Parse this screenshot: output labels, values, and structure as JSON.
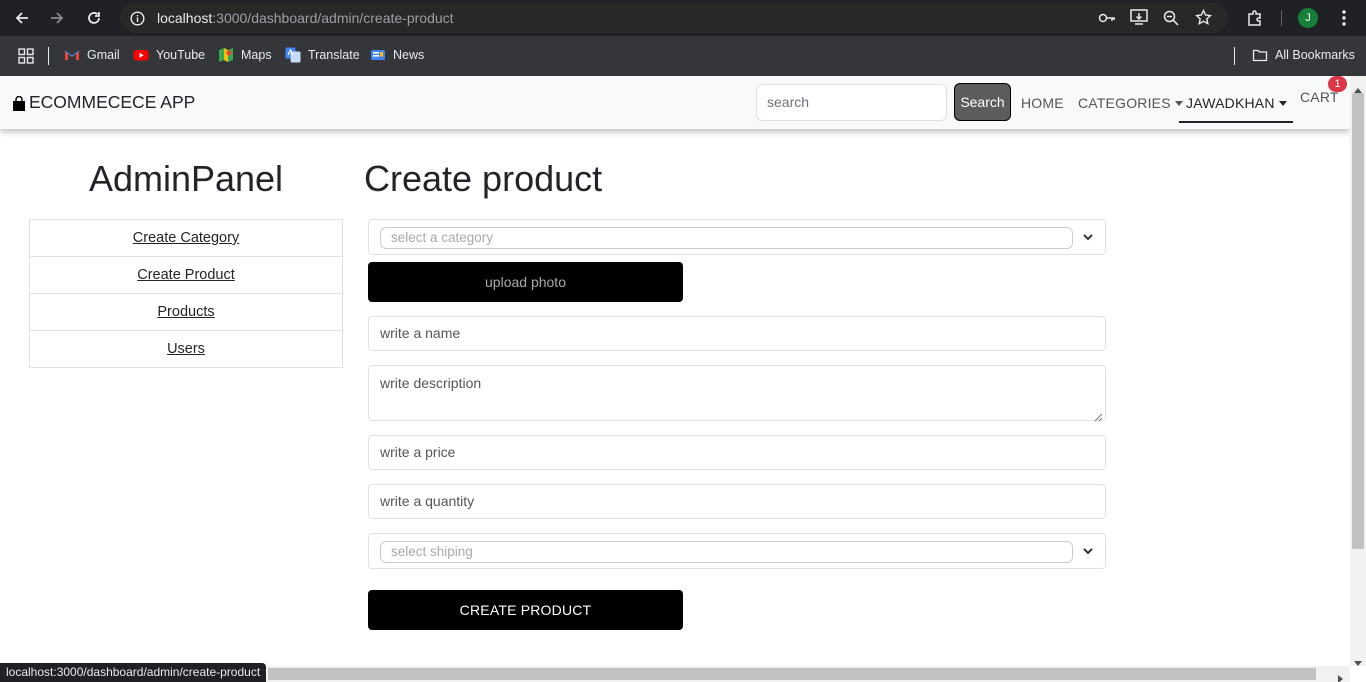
{
  "browser": {
    "url_host": "localhost",
    "url_path": ":3000/dashboard/admin/create-product",
    "status_url": "localhost:3000/dashboard/admin/create-product",
    "profile_initial": "J",
    "bookmarks": [
      {
        "label": "Gmail",
        "icon": "gmail-icon"
      },
      {
        "label": "YouTube",
        "icon": "youtube-icon"
      },
      {
        "label": "Maps",
        "icon": "maps-icon"
      },
      {
        "label": "Translate",
        "icon": "translate-icon"
      },
      {
        "label": "News",
        "icon": "news-icon"
      }
    ],
    "all_bookmarks": "All Bookmarks"
  },
  "navbar": {
    "brand": "ECOMMECECE APP",
    "search_placeholder": "search",
    "search_button": "Search",
    "home": "HOME",
    "categories": "CATEGORIES",
    "user": "JAWADKHAN",
    "cart": "CART",
    "cart_count": "1"
  },
  "sidebar": {
    "title": "AdminPanel",
    "items": [
      {
        "label": "Create Category"
      },
      {
        "label": "Create Product"
      },
      {
        "label": "Products"
      },
      {
        "label": "Users"
      }
    ]
  },
  "form": {
    "title": "Create product",
    "category_placeholder": "select a category",
    "upload_label": "upload photo",
    "name_placeholder": "write a name",
    "description_placeholder": "write description",
    "price_placeholder": "write a price",
    "quantity_placeholder": "write a quantity",
    "shipping_placeholder": "select shiping",
    "submit_label": "CREATE PRODUCT"
  },
  "colors": {
    "chrome_dark": "#202124",
    "navbar_bg": "#f8f9fa",
    "button_black": "#000000",
    "badge_red": "#dc3545",
    "profile_green": "#188038"
  }
}
